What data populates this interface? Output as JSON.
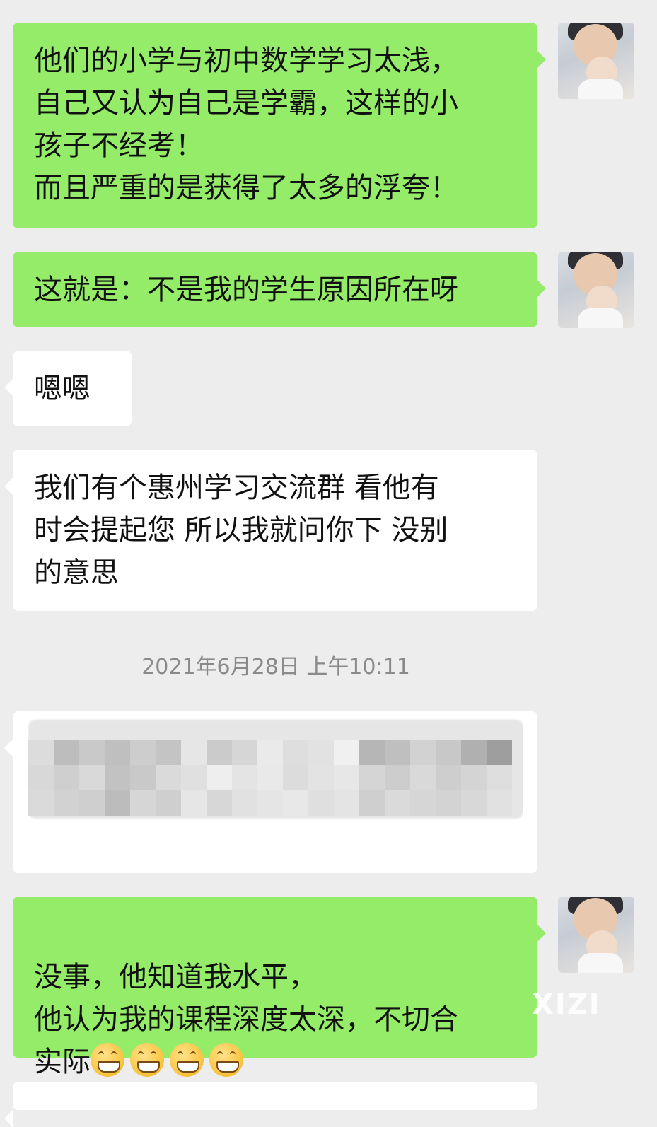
{
  "messages": [
    {
      "type": "out",
      "text": "他们的小学与初中数学学习太浅，\n自己又认为自己是学霸，这样的小\n孩子不经考！\n而且严重的是获得了太多的浮夸！"
    },
    {
      "type": "out",
      "text": "这就是：不是我的学生原因所在呀"
    },
    {
      "type": "in",
      "text": "嗯嗯"
    },
    {
      "type": "in",
      "text": "我们有个惠州学习交流群 看他有\n时会提起您 所以我就问你下 没别\n的意思"
    },
    {
      "type": "out",
      "text": "没事，他知道我水平，\n他认为我的课程深度太深，不切合\n实际"
    }
  ],
  "timestamp": "2021年6月28日 上午10:11",
  "emoji_count": 4,
  "watermark": "XIZI",
  "colors": {
    "outgoing": "#95ec69",
    "incoming": "#ffffff",
    "background": "#ededed"
  }
}
